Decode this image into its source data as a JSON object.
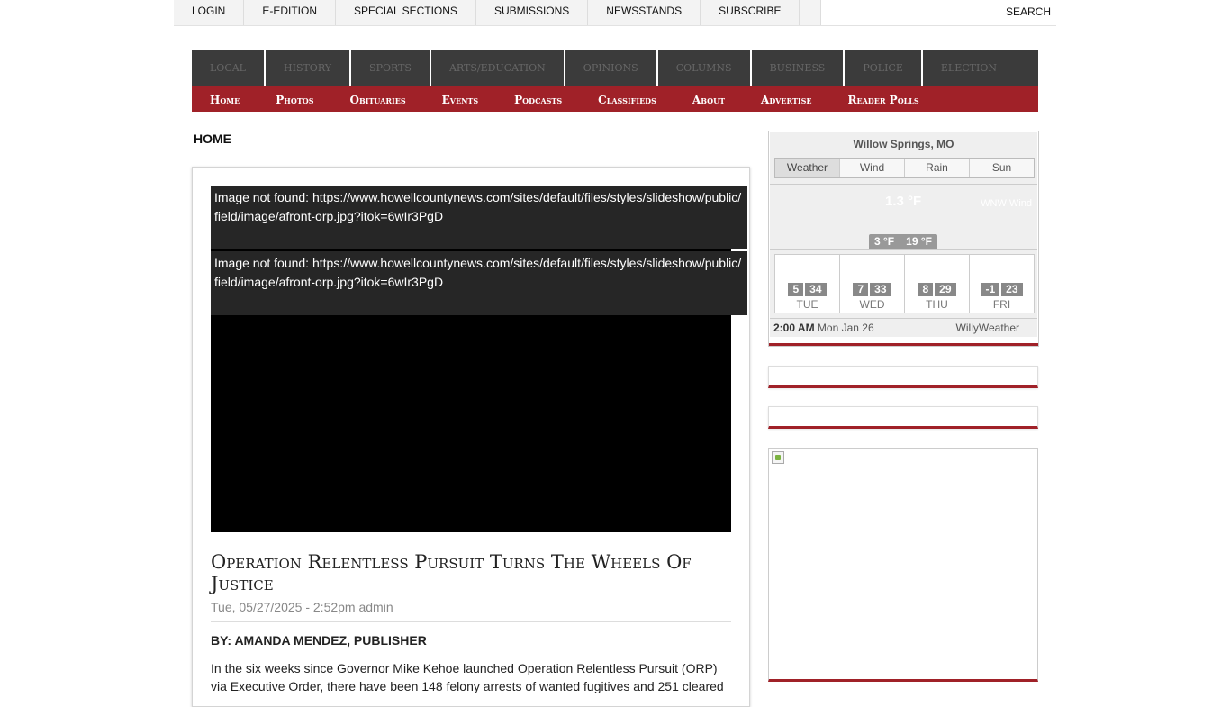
{
  "topbar": {
    "items": [
      "LOGIN",
      "E-EDITION",
      "SPECIAL SECTIONS",
      "SUBMISSIONS",
      "NEWSSTANDS",
      "SUBSCRIBE"
    ],
    "search_label": "SEARCH"
  },
  "section_nav": [
    "LOCAL",
    "HISTORY",
    "SPORTS",
    "ARTS/EDUCATION",
    "OPINIONS",
    "COLUMNS",
    "BUSINESS",
    "POLICE",
    "ELECTION"
  ],
  "main_nav": [
    "Home",
    "Photos",
    "Obituaries",
    "Events",
    "Podcasts",
    "Classifieds",
    "About",
    "Advertise",
    "Reader Polls"
  ],
  "page_heading": "HOME",
  "article": {
    "missing_images": [
      "Image not found: https://www.howellcountynews.com/sites/default/files/styles/slideshow/public/field/image/afront-orp.jpg?itok=6wIr3PgD",
      "Image not found: https://www.howellcountynews.com/sites/default/files/styles/slideshow/public/field/image/afront-orp.jpg?itok=6wIr3PgD"
    ],
    "title": "Operation Relentless Pursuit Turns The Wheels Of Justice",
    "meta": "Tue, 05/27/2025 - 2:52pm admin",
    "byline": "BY: AMANDA MENDEZ, PUBLISHER",
    "body": "In the six weeks since Governor Mike Kehoe launched Operation Relentless Pursuit (ORP) via Executive Order, there have been 148 felony arrests of wanted fugitives and 251 cleared"
  },
  "weather": {
    "city": "Willow Springs, MO",
    "tabs": [
      "Weather",
      "Wind",
      "Rain",
      "Sun"
    ],
    "active_tab": "Weather",
    "current_temp": "1.3 °F",
    "wind": "WNW Wind",
    "min": "3 °F",
    "max": "19 °F",
    "days": [
      {
        "name": "TUE",
        "low": "5",
        "high": "34"
      },
      {
        "name": "WED",
        "low": "7",
        "high": "33"
      },
      {
        "name": "THU",
        "low": "8",
        "high": "29"
      },
      {
        "name": "FRI",
        "low": "-1",
        "high": "23"
      }
    ],
    "time": "2:00 AM",
    "date": "Mon Jan 26",
    "brand": "WillyWeather"
  },
  "colors": {
    "nav_red": "#a02128",
    "section_nav_bg": "#3b3b3b",
    "topbar_bg": "#f3f3f3"
  }
}
